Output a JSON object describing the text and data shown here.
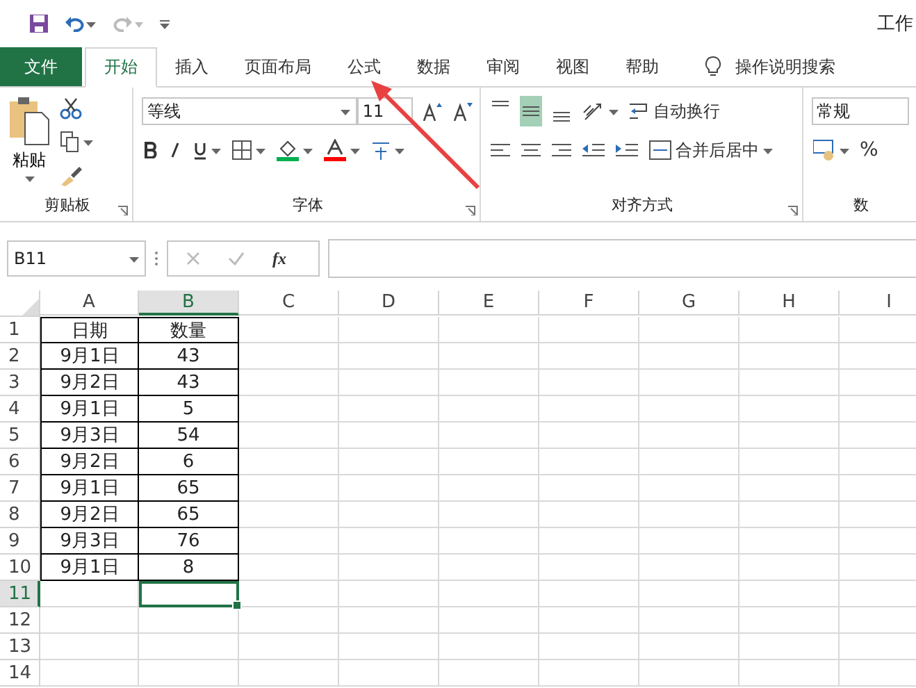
{
  "window": {
    "title": "工作"
  },
  "tabs": [
    {
      "label": "文件",
      "kind": "file",
      "selected": false
    },
    {
      "label": "开始",
      "kind": "tab",
      "selected": true
    },
    {
      "label": "插入",
      "kind": "tab",
      "selected": false
    },
    {
      "label": "页面布局",
      "kind": "tab",
      "selected": false
    },
    {
      "label": "公式",
      "kind": "tab",
      "selected": false
    },
    {
      "label": "数据",
      "kind": "tab",
      "selected": false
    },
    {
      "label": "审阅",
      "kind": "tab",
      "selected": false
    },
    {
      "label": "视图",
      "kind": "tab",
      "selected": false
    },
    {
      "label": "帮助",
      "kind": "tab",
      "selected": false
    }
  ],
  "tell_me": {
    "placeholder": "操作说明搜索"
  },
  "ribbon": {
    "clipboard": {
      "paste": "粘贴",
      "label": "剪贴板"
    },
    "font": {
      "font_name": "等线",
      "font_size": "11",
      "label": "字体"
    },
    "alignment": {
      "vertical_align": [
        {
          "selected": false
        },
        {
          "selected": true
        },
        {
          "selected": false
        }
      ],
      "wrap_text": "自动换行",
      "merge": "合并后居中",
      "label": "对齐方式"
    },
    "number": {
      "format": "常规",
      "percent": "%",
      "label": "数"
    }
  },
  "formula_bar": {
    "name_box": "B11",
    "fx": "fx"
  },
  "sheet": {
    "columns": [
      {
        "label": "A",
        "selected": false
      },
      {
        "label": "B",
        "selected": true
      },
      {
        "label": "C",
        "selected": false
      },
      {
        "label": "D",
        "selected": false
      },
      {
        "label": "E",
        "selected": false
      },
      {
        "label": "F",
        "selected": false
      },
      {
        "label": "G",
        "selected": false
      },
      {
        "label": "H",
        "selected": false
      },
      {
        "label": "I",
        "selected": false
      }
    ],
    "rows": [
      {
        "header": "1",
        "selected": false,
        "cells": [
          "日期",
          "数量"
        ]
      },
      {
        "header": "2",
        "selected": false,
        "cells": [
          "9月1日",
          "43"
        ]
      },
      {
        "header": "3",
        "selected": false,
        "cells": [
          "9月2日",
          "43"
        ]
      },
      {
        "header": "4",
        "selected": false,
        "cells": [
          "9月1日",
          "5"
        ]
      },
      {
        "header": "5",
        "selected": false,
        "cells": [
          "9月3日",
          "54"
        ]
      },
      {
        "header": "6",
        "selected": false,
        "cells": [
          "9月2日",
          "6"
        ]
      },
      {
        "header": "7",
        "selected": false,
        "cells": [
          "9月1日",
          "65"
        ]
      },
      {
        "header": "8",
        "selected": false,
        "cells": [
          "9月2日",
          "65"
        ]
      },
      {
        "header": "9",
        "selected": false,
        "cells": [
          "9月3日",
          "76"
        ]
      },
      {
        "header": "10",
        "selected": false,
        "cells": [
          "9月1日",
          "8"
        ]
      },
      {
        "header": "11",
        "selected": true
      },
      {
        "header": "12",
        "selected": false
      },
      {
        "header": "13",
        "selected": false
      },
      {
        "header": "14",
        "selected": false
      }
    ]
  }
}
